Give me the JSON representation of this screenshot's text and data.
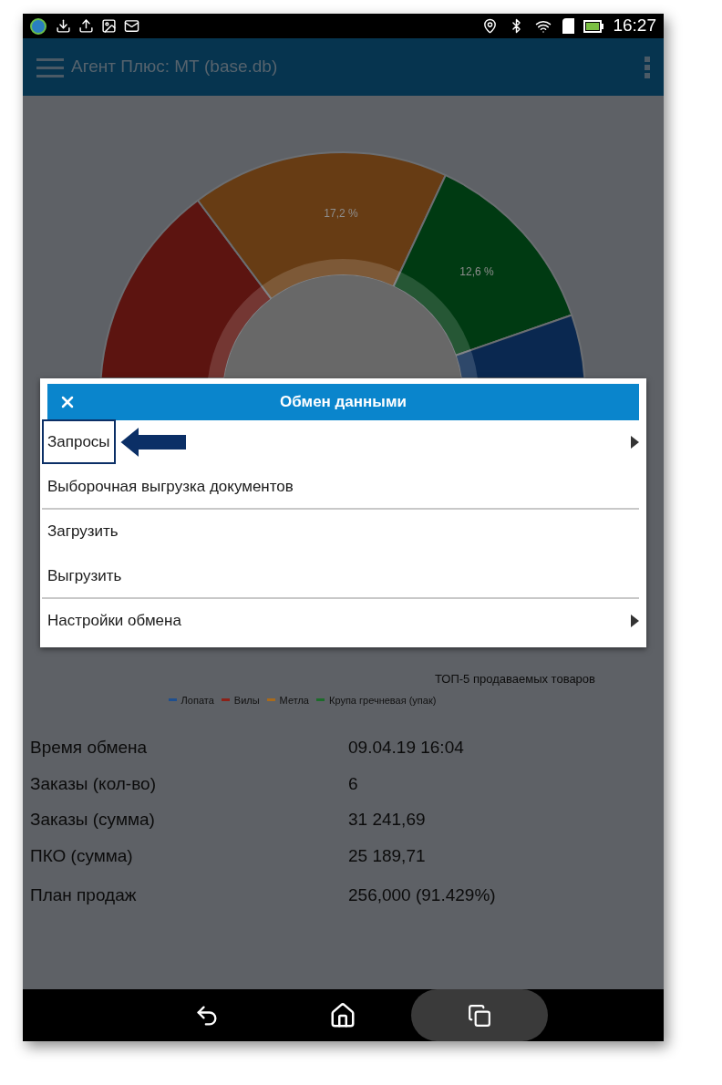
{
  "status_bar": {
    "time": "16:27"
  },
  "app_bar": {
    "title": "Агент Плюс: МТ (base.db)"
  },
  "chart": {
    "slice_labels": [
      "17,2 %",
      "12,6 %"
    ],
    "title": "ТОП-5 продаваемых товаров",
    "legend": [
      {
        "label": "Лопата",
        "color": "#1f4f8e"
      },
      {
        "label": "Вилы",
        "color": "#8c2118"
      },
      {
        "label": "Метла",
        "color": "#a86a1c"
      },
      {
        "label": "Крупа гречневая (упак)",
        "color": "#1c6b2a"
      }
    ]
  },
  "stats": [
    {
      "label": "Время обмена",
      "value": "09.04.19 16:04"
    },
    {
      "label": "Заказы (кол-во)",
      "value": "6"
    },
    {
      "label": "Заказы (сумма)",
      "value": "31 241,69"
    },
    {
      "label": "ПКО (сумма)",
      "value": "25 189,71"
    },
    {
      "label": "План продаж",
      "value": "256,000 (91.429%)"
    }
  ],
  "dialog": {
    "title": "Обмен данными",
    "items": [
      {
        "label": "Запросы",
        "has_submenu": true,
        "highlighted": true,
        "divider_after": false
      },
      {
        "label": "Выборочная выгрузка документов",
        "has_submenu": false,
        "highlighted": false,
        "divider_after": true
      },
      {
        "label": "Загрузить",
        "has_submenu": false,
        "highlighted": false,
        "divider_after": false
      },
      {
        "label": "Выгрузить",
        "has_submenu": false,
        "highlighted": false,
        "divider_after": true
      },
      {
        "label": "Настройки обмена",
        "has_submenu": true,
        "highlighted": false,
        "divider_after": false
      }
    ]
  }
}
